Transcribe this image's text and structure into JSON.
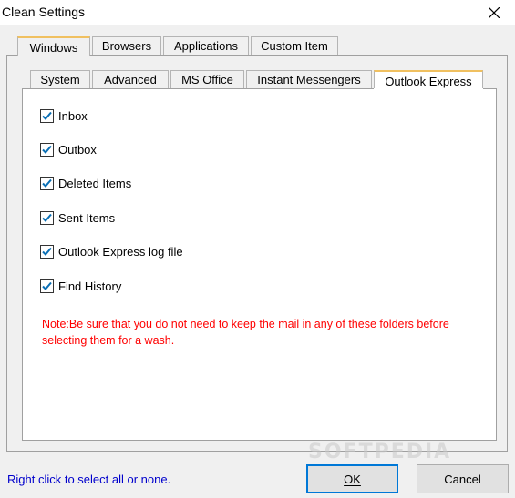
{
  "window": {
    "title": "Clean Settings"
  },
  "outer_tabs": [
    "Windows",
    "Browsers",
    "Applications",
    "Custom Item"
  ],
  "inner_tabs": [
    "System",
    "Advanced",
    "MS Office",
    "Instant Messengers",
    "Outlook Express"
  ],
  "checkboxes": [
    {
      "label": "Inbox",
      "checked": true
    },
    {
      "label": "Outbox",
      "checked": true
    },
    {
      "label": "Deleted Items",
      "checked": true
    },
    {
      "label": "Sent Items",
      "checked": true
    },
    {
      "label": "Outlook Express log file",
      "checked": true
    },
    {
      "label": "Find History",
      "checked": true
    }
  ],
  "note": "Note:Be sure that you do not need to keep the mail in any of these folders before selecting them for a wash.",
  "footer": {
    "hint": "Right click to select all or none.",
    "ok_label": "OK",
    "cancel_label": "Cancel"
  },
  "watermark": "SOFTPEDIA",
  "colors": {
    "note": "#ff0000",
    "hint": "#0000cc",
    "check": "#0a6fb5",
    "active_tab_accent": "#f0c060"
  }
}
